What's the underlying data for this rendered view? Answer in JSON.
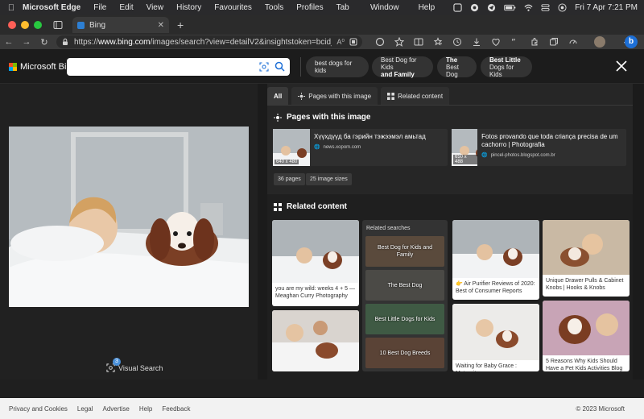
{
  "menubar": {
    "app": "Microsoft Edge",
    "items": [
      "File",
      "Edit",
      "View",
      "History",
      "Favourites",
      "Tools",
      "Profiles",
      "Tab"
    ],
    "right_items": [
      "Window",
      "Help"
    ],
    "clock": "Fri 7 Apr  7:21 PM"
  },
  "tab": {
    "title": "Bing"
  },
  "address": {
    "url_prefix": "https://",
    "url_domain": "www.bing.com",
    "url_rest": "/images/search?view=detailV2&insightstoken=bcid_RMLGijd9ZnMF...",
    "reader": "A⁰"
  },
  "header": {
    "logo": "Microsoft Bing",
    "search_value": "",
    "search_placeholder": "",
    "chips": [
      {
        "line1": "best dogs for kids",
        "line2": ""
      },
      {
        "line1": "Best Dog for Kids",
        "line2": "and Family"
      },
      {
        "line1": "The",
        "line2": "Best Dog"
      },
      {
        "line1": "Best Little",
        "line2": "Dogs for Kids"
      }
    ]
  },
  "left": {
    "visual_search_label": "Visual Search",
    "visual_search_badge": "3"
  },
  "right": {
    "tabs": [
      "All",
      "Pages with this image",
      "Related content"
    ],
    "pages_title": "Pages with this image",
    "pages": [
      {
        "title": "Хүүхдүүд ба гэрийн тэжээмэл амьтад",
        "source": "news.xopom.com",
        "dims": "640 x 480"
      },
      {
        "title": "Fotos provando que toda criança precisa de um cachorro | Photografia",
        "source": "pincel-photos.blogspot.com.br",
        "dims": "650 x 488"
      }
    ],
    "pills": [
      "36 pages",
      "25 image sizes"
    ],
    "related_title": "Related content",
    "related_searches_header": "Related searches",
    "related_searches": [
      "Best Dog for Kids and Family",
      "The Best Dog",
      "Best Little Dogs for Kids",
      "10 Best Dog Breeds"
    ],
    "cards": [
      "you are my wild: weeks 4 + 5 — Meaghan Curry Photography",
      "👉 Air Purifier Reviews of 2020: Best of Consumer Reports",
      "Unique Drawer Pulls & Cabinet Knobs | Hooks & Knobs",
      "Waiting for Baby Grace : Maternity",
      "5 Reasons Why Kids Should Have a Pet Kids Activities Blog"
    ]
  },
  "footer": {
    "links": [
      "Privacy and Cookies",
      "Legal",
      "Advertise",
      "Help",
      "Feedback"
    ],
    "copyright": "© 2023 Microsoft"
  }
}
